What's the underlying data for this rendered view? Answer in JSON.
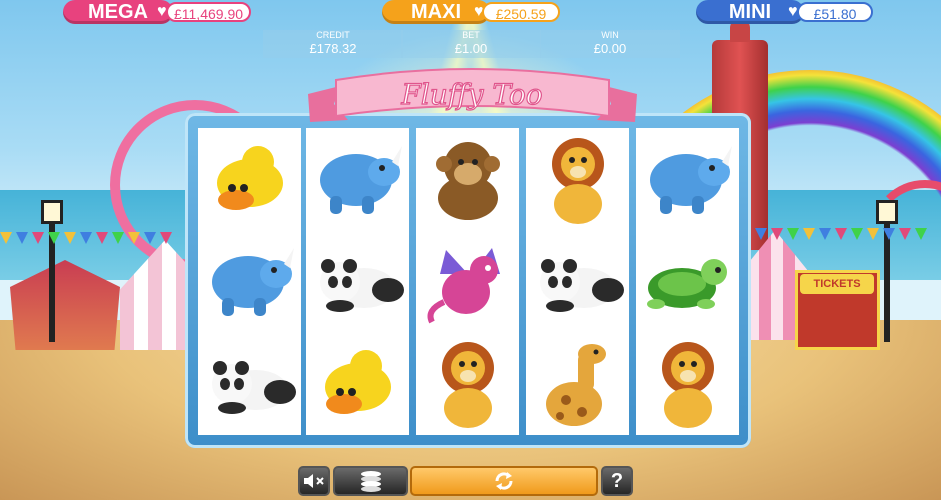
{
  "jackpots": [
    {
      "name": "MEGA",
      "value": "£11,469.90",
      "color": "#e8427e"
    },
    {
      "name": "MAXI",
      "value": "£250.59",
      "color": "#f5a21b"
    },
    {
      "name": "MINI",
      "value": "£51.80",
      "color": "#3a6fd0"
    }
  ],
  "info": {
    "credit_label": "CREDIT",
    "credit_value": "£178.32",
    "bet_label": "BET",
    "bet_value": "£1.00",
    "win_label": "WIN",
    "win_value": "£0.00"
  },
  "title": "Fluffy Too",
  "reels": [
    [
      "duck",
      "rhino",
      "panda"
    ],
    [
      "rhino",
      "panda",
      "duck"
    ],
    [
      "monkey",
      "dragon",
      "lion"
    ],
    [
      "lion",
      "panda",
      "giraffe"
    ],
    [
      "rhino",
      "turtle",
      "lion"
    ]
  ],
  "background": {
    "tickets_sign": "TICKETS"
  },
  "controls": {
    "mute_icon": "speaker-mute-icon",
    "stake_icon": "coin-stack-icon",
    "spin_icon": "spin-arrows-icon",
    "help_label": "?"
  }
}
